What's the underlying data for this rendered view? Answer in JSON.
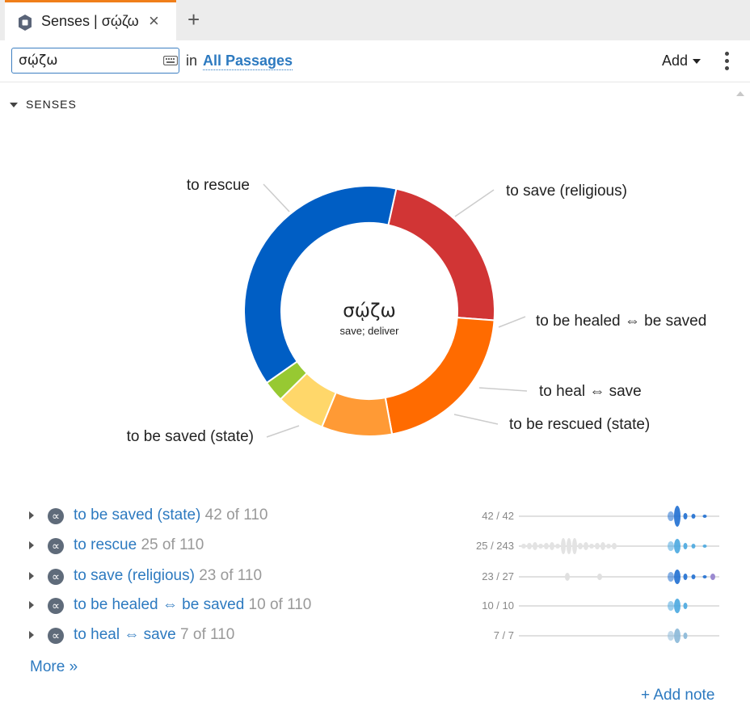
{
  "tab": {
    "title": "Senses | σῴζω",
    "close_label": "×",
    "add_label": "+",
    "icon": "document-icon"
  },
  "toolbar": {
    "search_value": "σῴζω",
    "in_label": "in",
    "passages_label": "All Passages",
    "add_label": "Add",
    "keyboard_icon": "keyboard-icon",
    "menu_icon": "kebab-menu-icon"
  },
  "section": {
    "title": "SENSES"
  },
  "chart_data": {
    "type": "pie",
    "style": "donut",
    "center_title": "σῴζω",
    "center_subtitle": "save; deliver",
    "slices": [
      {
        "label": "to be saved (state)",
        "value": 42,
        "color": "#005ec4"
      },
      {
        "label": "to rescue",
        "value": 25,
        "color": "#d13535"
      },
      {
        "label": "to save (religious)",
        "value": 23,
        "color": "#ff6b00"
      },
      {
        "label": "to be healed ⇔ be saved",
        "value": 10,
        "color": "#ff9a35"
      },
      {
        "label": "to heal ⇔ save",
        "value": 7,
        "color": "#ffd76a"
      },
      {
        "label": "to be rescued (state)",
        "value": 3,
        "color": "#97c932"
      }
    ],
    "total": 110
  },
  "senses": [
    {
      "label": "to be saved (state)",
      "count": "42 of 110",
      "fraction": "42 / 42"
    },
    {
      "label": "to rescue",
      "count": "25 of 110",
      "fraction": "25 / 243"
    },
    {
      "label": "to save (religious)",
      "count": "23 of 110",
      "fraction": "23 / 27"
    },
    {
      "label": "to be healed ⇔ be saved",
      "count": "10 of 110",
      "fraction": "10 / 10"
    },
    {
      "label": "to heal ⇔ save",
      "count": "7 of 110",
      "fraction": "7 / 7"
    }
  ],
  "more_label": "More »",
  "add_note_label": "+ Add note"
}
